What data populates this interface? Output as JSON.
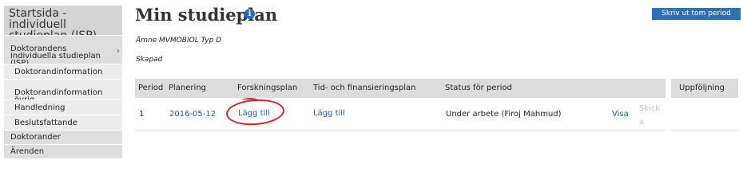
{
  "sidebar": {
    "header": "Startsida - individuell\nstudieplan (ISP)",
    "section": "Doktorandens\nindividuella studieplan\n(ISP)",
    "section_chevron": "chevron-right-icon",
    "items": [
      {
        "label": "Doktorandinformation"
      },
      {
        "label": "Doktorandinformation\növrig"
      },
      {
        "label": "Handledning"
      },
      {
        "label": "Beslutsfattande"
      },
      {
        "label": "Doktorander"
      },
      {
        "label": "Ärenden"
      }
    ]
  },
  "page": {
    "title": "Min studieplan",
    "info_icon": "info-icon",
    "print_button": "Skriv ut tom period",
    "subject": "Ämne MVMOBIOL Typ D",
    "created": "Skapad"
  },
  "table": {
    "headers": [
      "Period",
      "Planering",
      "Forskningsplan",
      "Tid- och finansieringsplan",
      "Status för period"
    ],
    "extra_header": "Uppföljning",
    "rows": [
      {
        "period": "1",
        "planering": "2016-05-12",
        "forskningsplan": "Lägg till",
        "tidplan": "Lägg till",
        "status": "Under arbete (Firoj Mahmud)",
        "visa": "Visa",
        "skicka": "Skick\na"
      }
    ]
  },
  "colors": {
    "sidebar_header": "#d4d4d4",
    "sidebar_item": "#e5e5e5",
    "button": "#2c70b8",
    "link": "#2457a3",
    "annotation": "#d82424"
  }
}
